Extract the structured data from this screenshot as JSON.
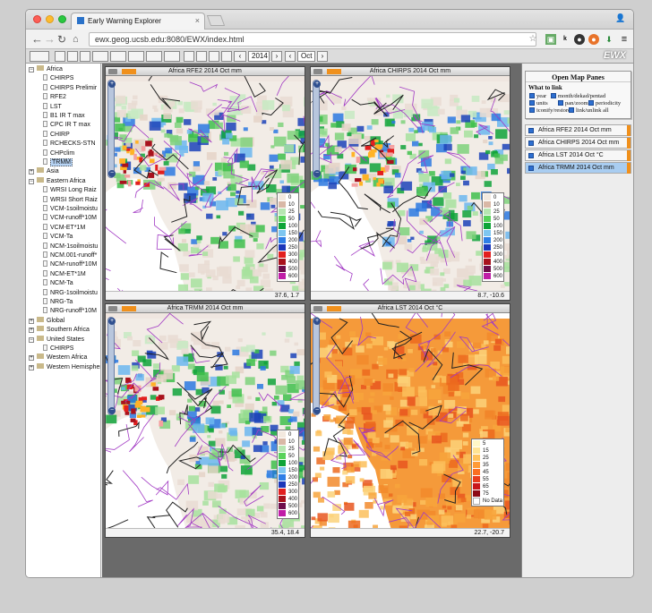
{
  "browser": {
    "tab_title": "Early Warning Explorer",
    "url": "ewx.geog.ucsb.edu:8080/EWX/index.html"
  },
  "toolbar": {
    "year": "2014",
    "month": "Oct",
    "brand": "EWX"
  },
  "tree": {
    "africa": "Africa",
    "africa_items": [
      "CHIRPS",
      "CHIRPS Prelimir",
      "RFE2",
      "LST",
      "B1 IR T max",
      "CPC IR T max",
      "CHIRP",
      "RCHECKS-STN",
      "CHPclim",
      "TRMM"
    ],
    "asia": "Asia",
    "eastern_africa": "Eastern Africa",
    "eastern_items": [
      "WRSI Long Raiz",
      "WRSI Short Raiz",
      "VCM-1soilmoistu",
      "VCM-runoff*10M",
      "VCM-ET*1M",
      "VCM-Ta",
      "NCM-1soilmoistu",
      "NCM.001-runoff*",
      "NCM-runoff*10M",
      "NCM-ET*1M",
      "NCM-Ta",
      "NRG-1soilmoistu",
      "NRG-Ta",
      "NRG-runoff*10M"
    ],
    "global": "Global",
    "southern_africa": "Southern Africa",
    "united_states": "United States",
    "us_items": [
      "CHIRPS"
    ],
    "western_africa": "Western Africa",
    "western_hemisphere": "Western Hemispher"
  },
  "panes": [
    {
      "title": "Africa RFE2 2014 Oct mm",
      "coords": "37.6, 1.7"
    },
    {
      "title": "Africa CHIRPS 2014 Oct mm",
      "coords": "8.7, -10.6"
    },
    {
      "title": "Africa TRMM 2014 Oct mm",
      "coords": "35.4, 18.4"
    },
    {
      "title": "Africa LST 2014 Oct °C",
      "coords": "22.7, -20.7"
    }
  ],
  "legend_precip": {
    "labels": [
      "0",
      "10",
      "25",
      "50",
      "100",
      "150",
      "200",
      "250",
      "300",
      "400",
      "500",
      "600"
    ],
    "colors": [
      "#f3e9df",
      "#d9b8a6",
      "#b6e6b1",
      "#58d25a",
      "#0ea437",
      "#7ec6f0",
      "#2f7fe6",
      "#1b36b9",
      "#e21f1f",
      "#a8121d",
      "#6e0d4b",
      "#c01da7"
    ]
  },
  "legend_temp": {
    "labels": [
      "5",
      "15",
      "25",
      "35",
      "45",
      "55",
      "65",
      "75",
      "No Data"
    ],
    "colors": [
      "#fff7c7",
      "#ffe393",
      "#ffc25c",
      "#ff9b37",
      "#fa6f22",
      "#e83d1d",
      "#c9161b",
      "#8c0b16",
      "#ffffff"
    ]
  },
  "right_panel": {
    "title": "Open Map Panes",
    "what_to_link": "What to link",
    "options": [
      "year",
      "month/dekad/pentad",
      "units",
      "pan/zoom",
      "periodicity",
      "iconify/restore",
      "link/unlink all"
    ],
    "pane_list": [
      "Africa RFE2 2014 Oct mm",
      "Africa CHIRPS 2014 Oct mm",
      "Africa LST 2014 Oct °C",
      "Africa TRMM 2014 Oct mm"
    ]
  },
  "colors": {
    "accent_orange": "#f0901c",
    "tree_selection": "#b7d4f5"
  }
}
